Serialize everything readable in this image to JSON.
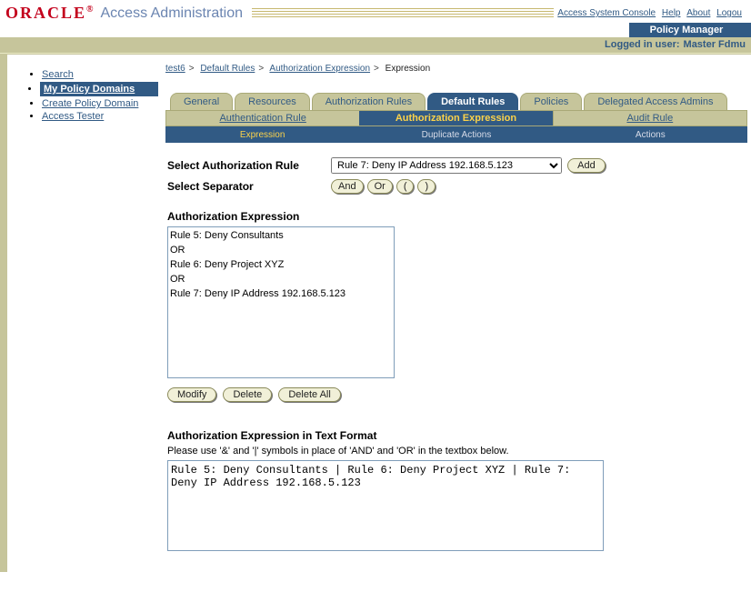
{
  "header": {
    "brand": "ORACLE",
    "subtitle": "Access Administration",
    "top_links": {
      "console": "Access System Console",
      "help": "Help",
      "about": "About",
      "logout": "Logou"
    },
    "app_name": "Policy Manager",
    "logged_in_label": "Logged in user:",
    "logged_in_user": "Master Fdmu"
  },
  "sidebar": {
    "items": [
      {
        "label": "Search"
      },
      {
        "label": "My Policy Domains"
      },
      {
        "label": "Create Policy Domain"
      },
      {
        "label": "Access Tester"
      }
    ]
  },
  "breadcrumb": {
    "parts": [
      "test6",
      "Default Rules",
      "Authorization Expression",
      "Expression"
    ]
  },
  "tabs": {
    "primary": [
      "General",
      "Resources",
      "Authorization Rules",
      "Default Rules",
      "Policies",
      "Delegated Access Admins"
    ],
    "secondary": [
      "Authentication Rule",
      "Authorization Expression",
      "Audit Rule"
    ],
    "tertiary": [
      "Expression",
      "Duplicate Actions",
      "Actions"
    ]
  },
  "form": {
    "select_rule_label": "Select Authorization Rule",
    "select_rule_value": "Rule 7: Deny IP Address 192.168.5.123",
    "add_btn": "Add",
    "select_sep_label": "Select Separator",
    "sep_and": "And",
    "sep_or": "Or",
    "sep_open": "(",
    "sep_close": ")",
    "expr_label": "Authorization Expression",
    "expr_lines": [
      "Rule 5: Deny Consultants",
      "OR",
      "Rule 6: Deny Project XYZ",
      "OR",
      "Rule 7: Deny IP Address 192.168.5.123"
    ],
    "modify_btn": "Modify",
    "delete_btn": "Delete",
    "delete_all_btn": "Delete All",
    "text_expr_label": "Authorization Expression in Text Format",
    "text_hint": "Please use '&' and '|' symbols in place of 'AND' and 'OR' in the textbox below.",
    "text_value": "Rule 5: Deny Consultants | Rule 6: Deny Project XYZ | Rule 7: Deny IP Address 192.168.5.123"
  }
}
